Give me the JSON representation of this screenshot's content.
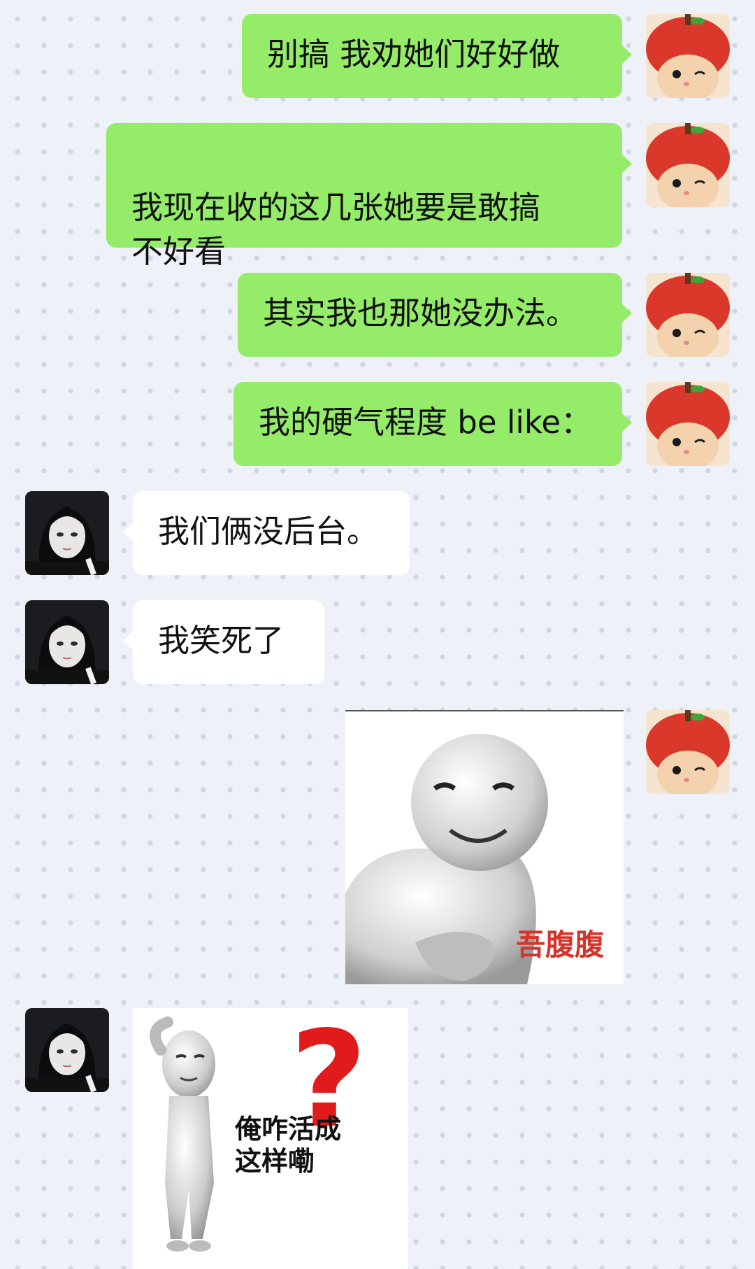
{
  "messages": [
    {
      "side": "right",
      "text": "别搞 我劝她们好好做"
    },
    {
      "side": "right",
      "text": "我现在收的这几张她要是敢搞\n不好看"
    },
    {
      "side": "right",
      "text": "其实我也那她没办法。"
    },
    {
      "side": "right",
      "text": "我的硬气程度 be like："
    },
    {
      "side": "left",
      "text": "我们俩没后台。"
    },
    {
      "side": "left",
      "text": "我笑死了"
    }
  ],
  "stickers": {
    "laugh_caption": "吾腹腹",
    "confused_caption_line1": "俺咋活成",
    "confused_caption_line2": "这样嘞",
    "question_mark": "?"
  },
  "avatars": {
    "me": "cat-in-tomato-hat-avatar",
    "friend": "dark-haired-girl-avatar"
  },
  "colors": {
    "sent_bubble": "#95ec69",
    "received_bubble": "#ffffff",
    "background": "#eef1f7",
    "caption_red": "#d8332b"
  }
}
